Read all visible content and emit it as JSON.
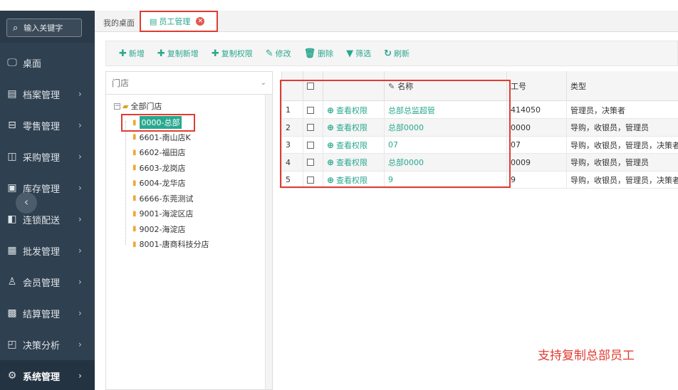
{
  "sidebar": {
    "search_placeholder": "输入关键字",
    "items": [
      {
        "label": "桌面",
        "icon": "monitor-icon",
        "glyph": "🖵",
        "has_arrow": false
      },
      {
        "label": "档案管理",
        "icon": "archive-icon",
        "glyph": "▤",
        "has_arrow": true
      },
      {
        "label": "零售管理",
        "icon": "retail-icon",
        "glyph": "⊟",
        "has_arrow": true
      },
      {
        "label": "采购管理",
        "icon": "purchase-icon",
        "glyph": "◫",
        "has_arrow": true
      },
      {
        "label": "库存管理",
        "icon": "inventory-icon",
        "glyph": "▣",
        "has_arrow": true
      },
      {
        "label": "连锁配送",
        "icon": "delivery-icon",
        "glyph": "◧",
        "has_arrow": true
      },
      {
        "label": "批发管理",
        "icon": "wholesale-icon",
        "glyph": "▦",
        "has_arrow": true
      },
      {
        "label": "会员管理",
        "icon": "member-icon",
        "glyph": "♙",
        "has_arrow": true
      },
      {
        "label": "结算管理",
        "icon": "settlement-icon",
        "glyph": "▩",
        "has_arrow": true
      },
      {
        "label": "决策分析",
        "icon": "analysis-icon",
        "glyph": "◰",
        "has_arrow": true
      },
      {
        "label": "系统管理",
        "icon": "settings-gear-icon",
        "glyph": "⚙",
        "has_arrow": true,
        "active": true
      }
    ],
    "arrow_glyph": "›",
    "collapse_glyph": "‹"
  },
  "tabs": {
    "desktop": "我的桌面",
    "active": "员工管理",
    "active_icon_glyph": "▤",
    "close_glyph": "✕"
  },
  "toolbar": [
    {
      "name": "add-button",
      "glyph": "✚",
      "label": "新增"
    },
    {
      "name": "copy-add-button",
      "glyph": "✚",
      "label": "复制新增"
    },
    {
      "name": "copy-permission-button",
      "glyph": "✚",
      "label": "复制权限"
    },
    {
      "name": "edit-button",
      "glyph": "✎",
      "label": "修改"
    },
    {
      "name": "delete-button",
      "glyph": "🗑",
      "label": "删除"
    },
    {
      "name": "filter-button",
      "glyph": "▼",
      "label": "筛选"
    },
    {
      "name": "refresh-button",
      "glyph": "↻",
      "label": "刷新"
    }
  ],
  "tree": {
    "select_label": "门店",
    "caret_glyph": "⌄",
    "root": "全部门店",
    "nodes": [
      {
        "label": "0000-总部",
        "selected": true
      },
      {
        "label": "6601-南山店K"
      },
      {
        "label": "6602-福田店"
      },
      {
        "label": "6603-龙岗店"
      },
      {
        "label": "6004-龙华店"
      },
      {
        "label": "6666-东莞测试"
      },
      {
        "label": "9001-海淀区店"
      },
      {
        "label": "9002-海淀店"
      },
      {
        "label": "8001-唐商科技分店"
      }
    ]
  },
  "grid": {
    "columns": {
      "name": "名称",
      "code": "工号",
      "type": "类型"
    },
    "name_icon_glyph": "✎",
    "perm_glyph": "⊕",
    "rows": [
      {
        "no": "1",
        "perm": "查看权限",
        "name": "总部总监超管",
        "code": "414050",
        "type": "管理员，决策者"
      },
      {
        "no": "2",
        "perm": "查看权限",
        "name": "总部0000",
        "code": "0000",
        "type": "导购，收银员，管理员"
      },
      {
        "no": "3",
        "perm": "查看权限",
        "name": "07",
        "code": "07",
        "type": "导购，收银员，管理员，决策者"
      },
      {
        "no": "4",
        "perm": "查看权限",
        "name": "总部0000",
        "code": "0009",
        "type": "导购，收银员，管理员"
      },
      {
        "no": "5",
        "perm": "查看权限",
        "name": "9",
        "code": "9",
        "type": "导购，收银员，管理员，决策者"
      }
    ]
  },
  "annotation": "支持复制总部员工"
}
